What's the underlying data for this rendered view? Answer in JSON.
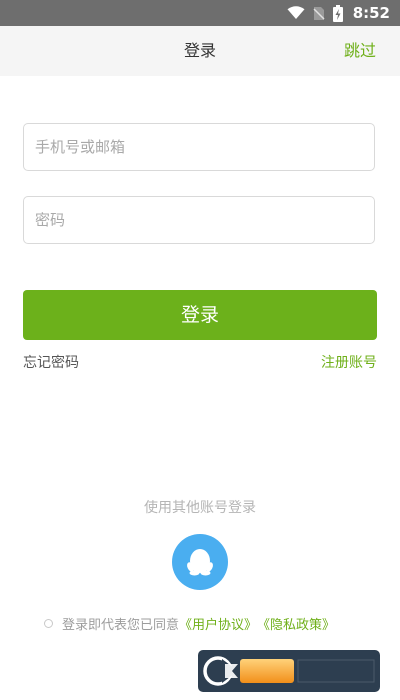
{
  "status_bar": {
    "time": "8:52",
    "icons": [
      "wifi-icon",
      "no-sim-icon",
      "battery-charging-icon"
    ]
  },
  "header": {
    "title": "登录",
    "skip_label": "跳过"
  },
  "form": {
    "account_placeholder": "手机号或邮箱",
    "password_placeholder": "密码",
    "login_label": "登录",
    "forgot_label": "忘记密码",
    "register_label": "注册账号"
  },
  "social": {
    "title": "使用其他账号登录",
    "icons": [
      "qq-icon"
    ]
  },
  "agreement": {
    "prefix": "登录即代表您已同意",
    "user_agreement": "《用户协议》",
    "privacy_policy": "《隐私政策》"
  },
  "colors": {
    "accent": "#6cb11b",
    "qq_blue": "#4aaef0",
    "status_bar": "#6e6e6e",
    "header_bg": "#f5f5f5"
  }
}
